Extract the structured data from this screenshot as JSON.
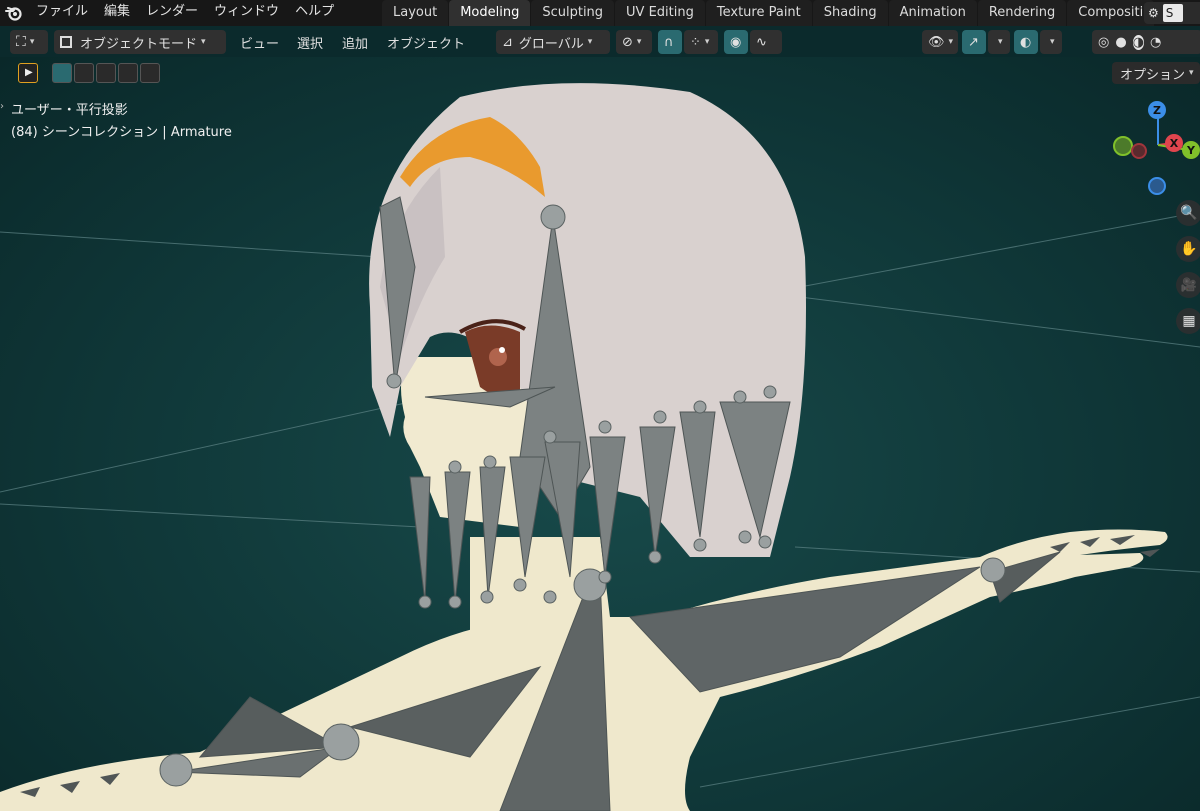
{
  "menu": {
    "items": [
      "ファイル",
      "編集",
      "レンダー",
      "ウィンドウ",
      "ヘルプ"
    ]
  },
  "workspace_tabs": [
    {
      "label": "Layout",
      "active": false
    },
    {
      "label": "Modeling",
      "active": true
    },
    {
      "label": "Sculpting",
      "active": false
    },
    {
      "label": "UV Editing",
      "active": false
    },
    {
      "label": "Texture Paint",
      "active": false
    },
    {
      "label": "Shading",
      "active": false
    },
    {
      "label": "Animation",
      "active": false
    },
    {
      "label": "Rendering",
      "active": false
    },
    {
      "label": "Compositi",
      "active": false
    }
  ],
  "scene": {
    "label": "S"
  },
  "header": {
    "mode": "オブジェクトモード",
    "view": "ビュー",
    "select": "選択",
    "add": "追加",
    "object": "オブジェクト",
    "transform_orientation": "グローバル"
  },
  "viewport": {
    "view_label": "ユーザー・平行投影",
    "collection_label": "(84) シーンコレクション | Armature",
    "options_label": "オプション"
  },
  "gizmo": {
    "z": "Z",
    "x": "X",
    "y": "Y"
  },
  "colors": {
    "accent": "#2a6a70",
    "active_tab": "#303030",
    "viewport_bg": "#0f3637",
    "gizmo_x": "#e0454e",
    "gizmo_y": "#80c02a",
    "gizmo_z": "#3b8ee8"
  }
}
